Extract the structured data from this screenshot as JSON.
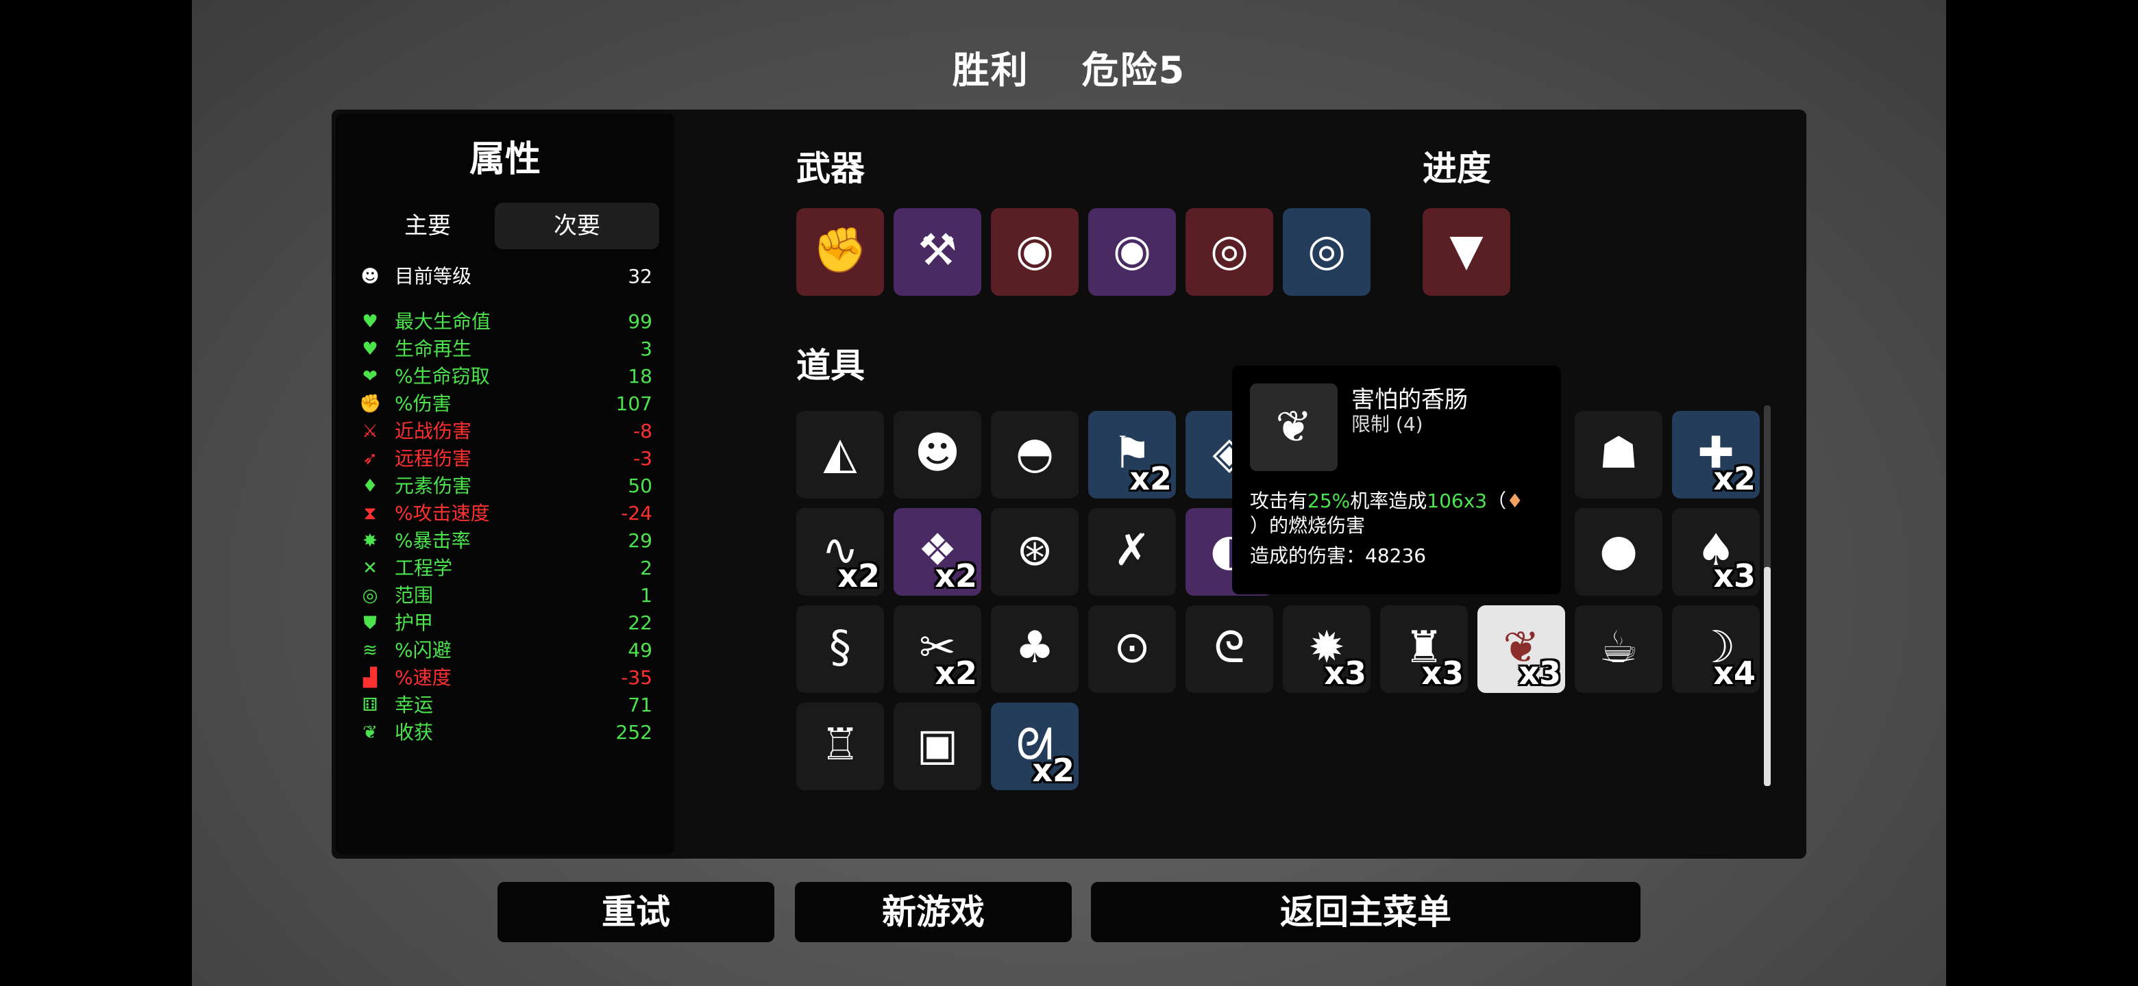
{
  "title": {
    "result": "胜利",
    "danger": "危险5"
  },
  "stats": {
    "title": "属性",
    "tabs": [
      "主要",
      "次要"
    ],
    "level": {
      "icon": "level-icon",
      "label": "目前等级",
      "value": "32"
    },
    "rows": [
      {
        "icon": "heart-icon",
        "label": "最大生命值",
        "value": "99",
        "color": "#4ce44c"
      },
      {
        "icon": "heart-regen-icon",
        "label": "生命再生",
        "value": "3",
        "color": "#4ce44c"
      },
      {
        "icon": "lifesteal-icon",
        "label": "%生命窃取",
        "value": "18",
        "color": "#4ce44c"
      },
      {
        "icon": "fist-icon",
        "label": "%伤害",
        "value": "107",
        "color": "#4ce44c"
      },
      {
        "icon": "sword-icon",
        "label": "近战伤害",
        "value": "-8",
        "color": "#ff3030"
      },
      {
        "icon": "bow-icon",
        "label": "远程伤害",
        "value": "-3",
        "color": "#ff3030"
      },
      {
        "icon": "flame-icon",
        "label": "元素伤害",
        "value": "50",
        "color": "#4ce44c"
      },
      {
        "icon": "hourglass-icon",
        "label": "%攻击速度",
        "value": "-24",
        "color": "#ff3030"
      },
      {
        "icon": "crit-icon",
        "label": "%暴击率",
        "value": "29",
        "color": "#4ce44c"
      },
      {
        "icon": "wrench-icon",
        "label": "工程学",
        "value": "2",
        "color": "#4ce44c"
      },
      {
        "icon": "range-icon",
        "label": "范围",
        "value": "1",
        "color": "#4ce44c"
      },
      {
        "icon": "shield-icon",
        "label": "护甲",
        "value": "22",
        "color": "#4ce44c"
      },
      {
        "icon": "dodge-icon",
        "label": "%闪避",
        "value": "49",
        "color": "#4ce44c"
      },
      {
        "icon": "boot-icon",
        "label": "%速度",
        "value": "-35",
        "color": "#ff3030"
      },
      {
        "icon": "dice-icon",
        "label": "幸运",
        "value": "71",
        "color": "#4ce44c"
      },
      {
        "icon": "harvest-icon",
        "label": "收获",
        "value": "252",
        "color": "#4ce44c"
      }
    ]
  },
  "weapons": {
    "title": "武器",
    "items": [
      {
        "name": "gauntlet-icon",
        "glyph": "✊",
        "tier": "red"
      },
      {
        "name": "hammer-icon",
        "glyph": "⚒",
        "tier": "purple"
      },
      {
        "name": "wisp-icon",
        "glyph": "◉",
        "tier": "red"
      },
      {
        "name": "wisp-icon",
        "glyph": "◉",
        "tier": "purple"
      },
      {
        "name": "spellbook-icon",
        "glyph": "◎",
        "tier": "red"
      },
      {
        "name": "spellbook-icon",
        "glyph": "◎",
        "tier": "blue"
      }
    ]
  },
  "progress": {
    "title": "进度",
    "items": [
      {
        "name": "anvil-icon",
        "glyph": "▼",
        "tier": "red"
      }
    ]
  },
  "items": {
    "title": "道具",
    "grid": [
      {
        "name": "cake-icon",
        "glyph": "◭",
        "tier": "",
        "qty": ""
      },
      {
        "name": "monkey-icon",
        "glyph": "☻",
        "tier": "",
        "qty": ""
      },
      {
        "name": "beanie-icon",
        "glyph": "◓",
        "tier": "",
        "qty": ""
      },
      {
        "name": "banner-icon",
        "glyph": "⚑",
        "tier": "blue",
        "qty": "x2"
      },
      {
        "name": "eye-badge-icon",
        "glyph": "◈",
        "tier": "blue",
        "qty": ""
      },
      {
        "name": "hidden-icon",
        "glyph": "",
        "tier": "",
        "qty": ""
      },
      {
        "name": "hidden-icon",
        "glyph": "",
        "tier": "",
        "qty": ""
      },
      {
        "name": "hidden-icon",
        "glyph": "",
        "tier": "",
        "qty": ""
      },
      {
        "name": "ghost-icon",
        "glyph": "☗",
        "tier": "",
        "qty": ""
      },
      {
        "name": "medkit-icon",
        "glyph": "✚",
        "tier": "blue",
        "qty": "x2"
      },
      {
        "name": "worm-icon",
        "glyph": "∿",
        "tier": "",
        "qty": "x2"
      },
      {
        "name": "cat-icon",
        "glyph": "❖",
        "tier": "purple",
        "qty": "x2"
      },
      {
        "name": "ufo-icon",
        "glyph": "⊛",
        "tier": "",
        "qty": ""
      },
      {
        "name": "scar-icon",
        "glyph": "✗",
        "tier": "",
        "qty": ""
      },
      {
        "name": "hood-icon",
        "glyph": "◐",
        "tier": "purple",
        "qty": ""
      },
      {
        "name": "hidden-icon",
        "glyph": "",
        "tier": "",
        "qty": ""
      },
      {
        "name": "hidden-icon",
        "glyph": "",
        "tier": "",
        "qty": ""
      },
      {
        "name": "hidden-icon",
        "glyph": "",
        "tier": "",
        "qty": ""
      },
      {
        "name": "blob-icon",
        "glyph": "●",
        "tier": "",
        "qty": ""
      },
      {
        "name": "bat-icon",
        "glyph": "♠",
        "tier": "",
        "qty": "x3"
      },
      {
        "name": "snake-icon",
        "glyph": "§",
        "tier": "",
        "qty": ""
      },
      {
        "name": "claw-icon",
        "glyph": "✂",
        "tier": "",
        "qty": "x2"
      },
      {
        "name": "sprout-icon",
        "glyph": "♣",
        "tier": "",
        "qty": ""
      },
      {
        "name": "turret-icon",
        "glyph": "⊙",
        "tier": "",
        "qty": ""
      },
      {
        "name": "tentacle-icon",
        "glyph": "ᘓ",
        "tier": "",
        "qty": ""
      },
      {
        "name": "spiky-icon",
        "glyph": "✹",
        "tier": "",
        "qty": "x3"
      },
      {
        "name": "sack-icon",
        "glyph": "♜",
        "tier": "",
        "qty": "x3"
      },
      {
        "name": "scared-sausage-icon",
        "glyph": "❦",
        "tier": "white",
        "qty": "x3"
      },
      {
        "name": "cup-icon",
        "glyph": "☕",
        "tier": "",
        "qty": ""
      },
      {
        "name": "tooth-icon",
        "glyph": "☽",
        "tier": "",
        "qty": "x4"
      },
      {
        "name": "jacket-icon",
        "glyph": "♖",
        "tier": "",
        "qty": ""
      },
      {
        "name": "cash-icon",
        "glyph": "▣",
        "tier": "",
        "qty": ""
      },
      {
        "name": "rabbit-icon",
        "glyph": "ᘛ",
        "tier": "blue",
        "qty": "x2"
      }
    ]
  },
  "tooltip": {
    "icon": "scared-sausage-icon",
    "glyph": "❦",
    "name": "害怕的香肠",
    "limit": "限制 (4)",
    "desc_a": "攻击有",
    "desc_chance": "25%",
    "desc_b": "机率造成",
    "desc_damage": "106",
    "desc_mult": "x3",
    "desc_c": "（",
    "desc_d": "）的燃烧伤害",
    "damage_label": "造成的伤害：48236"
  },
  "buttons": {
    "retry": "重试",
    "new_game": "新游戏",
    "main_menu": "返回主菜单"
  },
  "colors": {
    "green": "#4ce44c",
    "red": "#ff3030",
    "tier_red": "#5a1f24",
    "tier_purple": "#4a2a63",
    "tier_blue": "#243d5a"
  }
}
